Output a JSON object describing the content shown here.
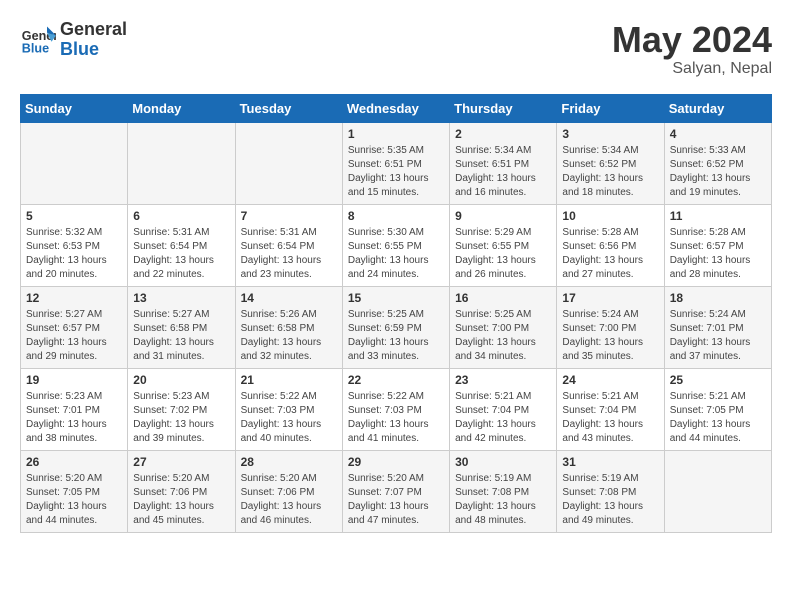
{
  "header": {
    "logo_line1": "General",
    "logo_line2": "Blue",
    "month_year": "May 2024",
    "location": "Salyan, Nepal"
  },
  "weekdays": [
    "Sunday",
    "Monday",
    "Tuesday",
    "Wednesday",
    "Thursday",
    "Friday",
    "Saturday"
  ],
  "weeks": [
    [
      {
        "day": "",
        "info": ""
      },
      {
        "day": "",
        "info": ""
      },
      {
        "day": "",
        "info": ""
      },
      {
        "day": "1",
        "info": "Sunrise: 5:35 AM\nSunset: 6:51 PM\nDaylight: 13 hours and 15 minutes."
      },
      {
        "day": "2",
        "info": "Sunrise: 5:34 AM\nSunset: 6:51 PM\nDaylight: 13 hours and 16 minutes."
      },
      {
        "day": "3",
        "info": "Sunrise: 5:34 AM\nSunset: 6:52 PM\nDaylight: 13 hours and 18 minutes."
      },
      {
        "day": "4",
        "info": "Sunrise: 5:33 AM\nSunset: 6:52 PM\nDaylight: 13 hours and 19 minutes."
      }
    ],
    [
      {
        "day": "5",
        "info": "Sunrise: 5:32 AM\nSunset: 6:53 PM\nDaylight: 13 hours and 20 minutes."
      },
      {
        "day": "6",
        "info": "Sunrise: 5:31 AM\nSunset: 6:54 PM\nDaylight: 13 hours and 22 minutes."
      },
      {
        "day": "7",
        "info": "Sunrise: 5:31 AM\nSunset: 6:54 PM\nDaylight: 13 hours and 23 minutes."
      },
      {
        "day": "8",
        "info": "Sunrise: 5:30 AM\nSunset: 6:55 PM\nDaylight: 13 hours and 24 minutes."
      },
      {
        "day": "9",
        "info": "Sunrise: 5:29 AM\nSunset: 6:55 PM\nDaylight: 13 hours and 26 minutes."
      },
      {
        "day": "10",
        "info": "Sunrise: 5:28 AM\nSunset: 6:56 PM\nDaylight: 13 hours and 27 minutes."
      },
      {
        "day": "11",
        "info": "Sunrise: 5:28 AM\nSunset: 6:57 PM\nDaylight: 13 hours and 28 minutes."
      }
    ],
    [
      {
        "day": "12",
        "info": "Sunrise: 5:27 AM\nSunset: 6:57 PM\nDaylight: 13 hours and 29 minutes."
      },
      {
        "day": "13",
        "info": "Sunrise: 5:27 AM\nSunset: 6:58 PM\nDaylight: 13 hours and 31 minutes."
      },
      {
        "day": "14",
        "info": "Sunrise: 5:26 AM\nSunset: 6:58 PM\nDaylight: 13 hours and 32 minutes."
      },
      {
        "day": "15",
        "info": "Sunrise: 5:25 AM\nSunset: 6:59 PM\nDaylight: 13 hours and 33 minutes."
      },
      {
        "day": "16",
        "info": "Sunrise: 5:25 AM\nSunset: 7:00 PM\nDaylight: 13 hours and 34 minutes."
      },
      {
        "day": "17",
        "info": "Sunrise: 5:24 AM\nSunset: 7:00 PM\nDaylight: 13 hours and 35 minutes."
      },
      {
        "day": "18",
        "info": "Sunrise: 5:24 AM\nSunset: 7:01 PM\nDaylight: 13 hours and 37 minutes."
      }
    ],
    [
      {
        "day": "19",
        "info": "Sunrise: 5:23 AM\nSunset: 7:01 PM\nDaylight: 13 hours and 38 minutes."
      },
      {
        "day": "20",
        "info": "Sunrise: 5:23 AM\nSunset: 7:02 PM\nDaylight: 13 hours and 39 minutes."
      },
      {
        "day": "21",
        "info": "Sunrise: 5:22 AM\nSunset: 7:03 PM\nDaylight: 13 hours and 40 minutes."
      },
      {
        "day": "22",
        "info": "Sunrise: 5:22 AM\nSunset: 7:03 PM\nDaylight: 13 hours and 41 minutes."
      },
      {
        "day": "23",
        "info": "Sunrise: 5:21 AM\nSunset: 7:04 PM\nDaylight: 13 hours and 42 minutes."
      },
      {
        "day": "24",
        "info": "Sunrise: 5:21 AM\nSunset: 7:04 PM\nDaylight: 13 hours and 43 minutes."
      },
      {
        "day": "25",
        "info": "Sunrise: 5:21 AM\nSunset: 7:05 PM\nDaylight: 13 hours and 44 minutes."
      }
    ],
    [
      {
        "day": "26",
        "info": "Sunrise: 5:20 AM\nSunset: 7:05 PM\nDaylight: 13 hours and 44 minutes."
      },
      {
        "day": "27",
        "info": "Sunrise: 5:20 AM\nSunset: 7:06 PM\nDaylight: 13 hours and 45 minutes."
      },
      {
        "day": "28",
        "info": "Sunrise: 5:20 AM\nSunset: 7:06 PM\nDaylight: 13 hours and 46 minutes."
      },
      {
        "day": "29",
        "info": "Sunrise: 5:20 AM\nSunset: 7:07 PM\nDaylight: 13 hours and 47 minutes."
      },
      {
        "day": "30",
        "info": "Sunrise: 5:19 AM\nSunset: 7:08 PM\nDaylight: 13 hours and 48 minutes."
      },
      {
        "day": "31",
        "info": "Sunrise: 5:19 AM\nSunset: 7:08 PM\nDaylight: 13 hours and 49 minutes."
      },
      {
        "day": "",
        "info": ""
      }
    ]
  ]
}
